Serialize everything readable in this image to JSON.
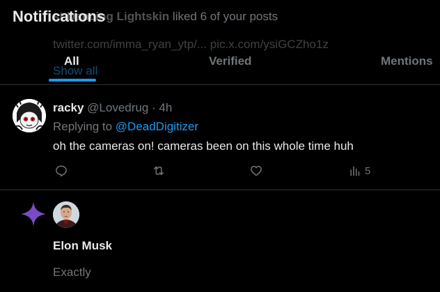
{
  "header": {
    "title": "Notifications",
    "tabs": [
      {
        "label": "All",
        "selected": true
      },
      {
        "label": "Verified",
        "selected": false
      },
      {
        "label": "Mentions",
        "selected": false
      }
    ]
  },
  "ghost_notification": {
    "name": "st Dancing Lightskin",
    "action": "liked 6 of your posts",
    "links": "twitter.com/imma_ryan_ytp/... pic.x.com/ysiGCZho1z",
    "show_all": "Show all"
  },
  "tweet": {
    "name": "racky",
    "handle_time": "@Lovedrug · 4h",
    "replying_prefix": "Replying to ",
    "replying_to": "@DeadDigitizer",
    "text": "oh the cameras on! cameras been on this whole time huh",
    "views": "5"
  },
  "notification": {
    "name": "Elon Musk",
    "text": "Exactly"
  },
  "colors": {
    "accent": "#1d9bf0",
    "sparkle": "#794bc4",
    "divider": "#2f3336",
    "muted": "#71767b"
  }
}
